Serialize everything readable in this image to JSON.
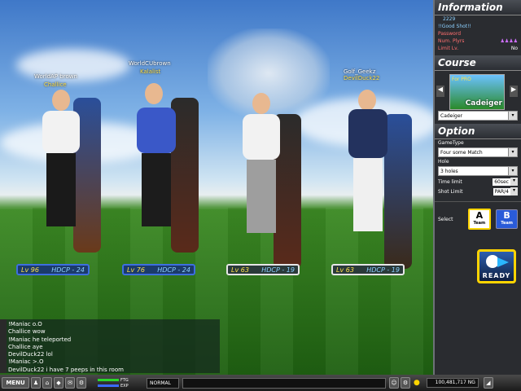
{
  "players": [
    {
      "name": "WorldAP brown",
      "club": "Challice",
      "level": "Lv 96",
      "hdcp": "HDCP - 24",
      "badge": "blue"
    },
    {
      "name": "WorldCUbrown",
      "club": "Kalalist",
      "level": "Lv 76",
      "hdcp": "HDCP - 24",
      "badge": "blue"
    },
    {
      "name": "",
      "club": "",
      "level": "Lv 63",
      "hdcp": "HDCP - 19",
      "badge": "white"
    },
    {
      "name": "Golf_Geekz",
      "club": "DevilDuck22",
      "level": "Lv 63",
      "hdcp": "HDCP - 19",
      "badge": "white"
    }
  ],
  "chat": {
    "lines": [
      "!Maniac o.O",
      "Challice wow",
      "!Maniac he teleported",
      "Challice aye",
      "DevilDuck22 lol",
      "!Maniac >.O",
      "DevilDuck22 i have 7 peeps in this room"
    ]
  },
  "bottombar": {
    "menu_label": "MENU",
    "ftg_label": "FTG",
    "exp_label": "EXP",
    "mode": "NORMAL",
    "money": "100,481,717 NG"
  },
  "panel": {
    "info_title": "Information",
    "room_number": "2229",
    "room_name": "!!Good Shot!!",
    "password_label": "Password",
    "num_players_label": "Num. Plyrs",
    "limit_label": "Limit Lv.",
    "limit_value": "No",
    "course_title": "Course",
    "course_name_big": "Cadeiger",
    "course_level": "For PRO",
    "course_select": "Cadeiger",
    "option_title": "Option",
    "gametype_label": "GameType",
    "gametype_value": "Four some Match",
    "hole_label": "Hole",
    "hole_value": "3 holes",
    "time_label": "Time limit",
    "time_value": "60sec",
    "shot_label": "Shot Limit",
    "shot_value": "PAR/4",
    "select_label": "Select",
    "team_a": "A",
    "team_b": "B",
    "team_word": "Team",
    "ready_label": "READY"
  },
  "colors": {
    "accent_red": "#ff6f6f",
    "team_a": "#ffffff",
    "team_b": "#2a5bd8",
    "ready_border": "#ffd400"
  }
}
